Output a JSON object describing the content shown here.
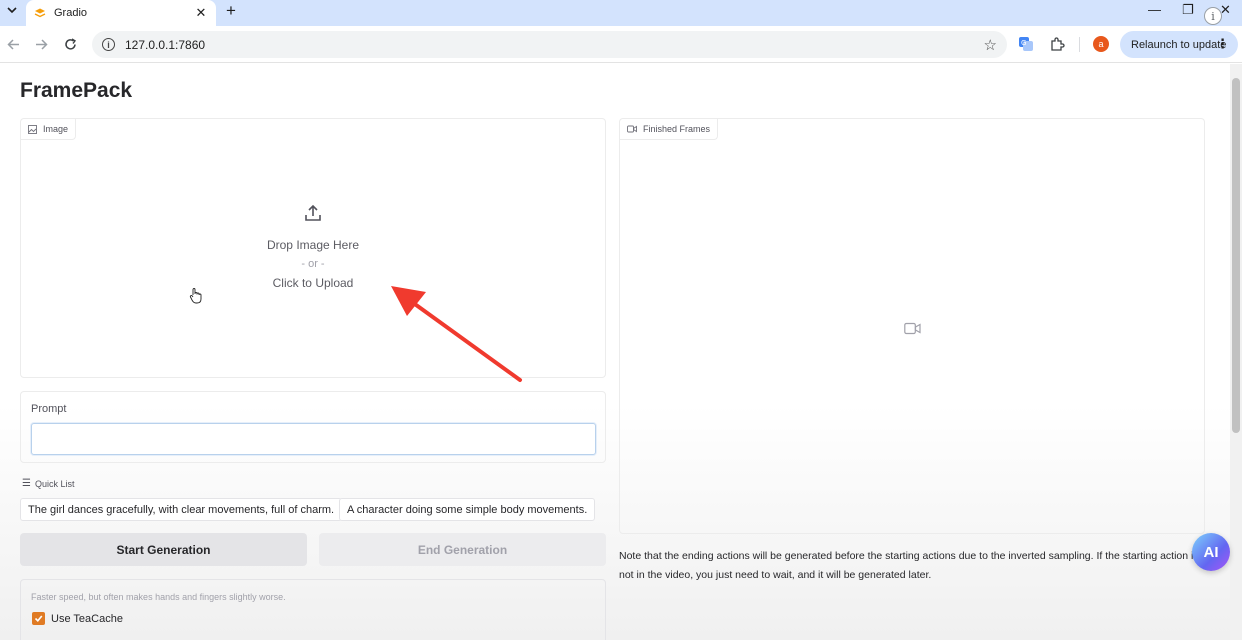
{
  "browser": {
    "tab_title": "Gradio",
    "tab_close_glyph": "✕",
    "new_tab_glyph": "+",
    "url": "127.0.0.1:7860",
    "relaunch_label": "Relaunch to update",
    "avatar_letter": "a",
    "window_controls": {
      "minimize": "—",
      "restore": "❐",
      "close": "✕"
    }
  },
  "app": {
    "title": "FramePack",
    "image_block": {
      "label": "Image",
      "drop_text": "Drop Image Here",
      "or_text": "- or -",
      "click_text": "Click to Upload"
    },
    "prompt": {
      "label": "Prompt",
      "value": ""
    },
    "quick_list": {
      "label": "Quick List",
      "items": [
        "The girl dances gracefully, with clear movements, full of charm.",
        "A character doing some simple body movements."
      ]
    },
    "buttons": {
      "start": "Start Generation",
      "end": "End Generation"
    },
    "teacache": {
      "info": "Faster speed, but often makes hands and fingers slightly worse.",
      "label": "Use TeaCache",
      "checked": true
    },
    "finished_frames": {
      "label": "Finished Frames"
    },
    "note": "Note that the ending actions will be generated before the starting actions due to the inverted sampling. If the starting action is not in the video, you just need to wait, and it will be generated later."
  },
  "overlay": {
    "badge_text": "AI"
  },
  "colors": {
    "accent_orange": "#e07b24",
    "annotation_red": "#f03a2e",
    "chrome_blue": "#d3e3fd"
  }
}
